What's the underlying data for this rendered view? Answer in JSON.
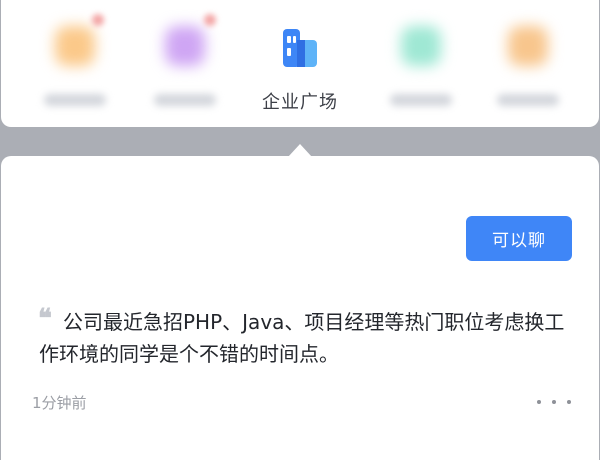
{
  "tabs": {
    "active_label": "企业广场",
    "items": [
      {
        "blurred": true,
        "color": "#fbc98a"
      },
      {
        "blurred": true,
        "color": "#cfa6f4"
      },
      {
        "label": "企业广场",
        "icon": "building-icon",
        "color": "#3e86f6"
      },
      {
        "blurred": true,
        "color": "#9fe8d4"
      },
      {
        "blurred": true,
        "color": "#f8c68d"
      }
    ]
  },
  "card": {
    "chat_button_label": "可以聊",
    "quote_mark": "❝",
    "quote_text": "公司最近急招PHP、Java、项目经理等热门职位考虑换工作环境的同学是个不错的时间点。",
    "timestamp": "1分钟前",
    "more_icon": "more-dots-icon"
  },
  "colors": {
    "accent": "#3f86f7",
    "backdrop": "#abaeb5"
  }
}
